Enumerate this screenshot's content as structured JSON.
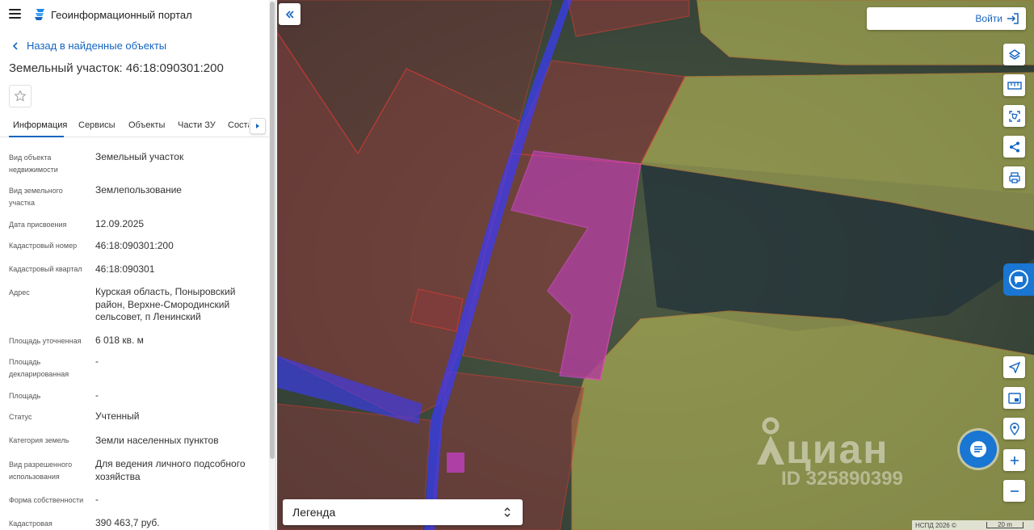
{
  "header": {
    "portal_title": "Геоинформационный портал"
  },
  "nav": {
    "back_label": "Назад в найденные объекты"
  },
  "object": {
    "title": "Земельный участок: 46:18:090301:200"
  },
  "tabs": [
    {
      "label": "Информация",
      "active": true
    },
    {
      "label": "Сервисы"
    },
    {
      "label": "Объекты"
    },
    {
      "label": "Части ЗУ"
    },
    {
      "label": "Соста"
    }
  ],
  "properties": [
    {
      "label": "Вид объекта недвижимости",
      "value": "Земельный участок"
    },
    {
      "label": "Вид земельного участка",
      "value": "Землепользование"
    },
    {
      "label": "Дата присвоения",
      "value": "12.09.2025"
    },
    {
      "label": "Кадастровый номер",
      "value": "46:18:090301:200"
    },
    {
      "label": "Кадастровый квартал",
      "value": "46:18:090301"
    },
    {
      "label": "Адрес",
      "value": "Курская область, Поныровский район, Верхне-Смородинский сельсовет, п Ленинский"
    },
    {
      "label": "Площадь уточненная",
      "value": "6 018 кв. м"
    },
    {
      "label": "Площадь декларированная",
      "value": "-"
    },
    {
      "label": "Площадь",
      "value": "-"
    },
    {
      "label": "Статус",
      "value": "Учтенный"
    },
    {
      "label": "Категория земель",
      "value": "Земли населенных пунктов"
    },
    {
      "label": "Вид разрешенного использования",
      "value": "Для ведения личного подсобного хозяйства"
    },
    {
      "label": "Форма собственности",
      "value": "-"
    },
    {
      "label": "Кадастровая",
      "value": "390 463,7 руб."
    }
  ],
  "map": {
    "login_label": "Войти",
    "legend_label": "Легенда",
    "attribution": "НСПД 2026 ©",
    "scale_label": "20 m",
    "watermark_brand": "циан",
    "watermark_id": "ID 325890399"
  },
  "colors": {
    "accent": "#1565c0",
    "parcel_outline": "#e53935",
    "selected_parcel": "#c040c0",
    "road_zone": "#3a3aff",
    "farmland_fill": "#c8c85a"
  }
}
